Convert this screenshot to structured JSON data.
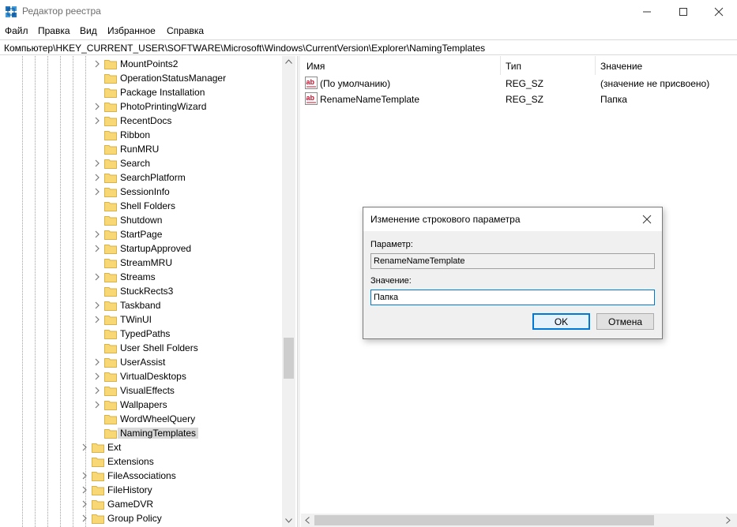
{
  "window": {
    "title": "Редактор реестра"
  },
  "menu": [
    "Файл",
    "Правка",
    "Вид",
    "Избранное",
    "Справка"
  ],
  "address": "Компьютер\\HKEY_CURRENT_USER\\SOFTWARE\\Microsoft\\Windows\\CurrentVersion\\Explorer\\NamingTemplates",
  "tree": {
    "items": [
      {
        "label": "MountPoints2",
        "expandable": true,
        "level": 2,
        "selected": false
      },
      {
        "label": "OperationStatusManager",
        "expandable": false,
        "level": 2,
        "selected": false
      },
      {
        "label": "Package Installation",
        "expandable": false,
        "level": 2,
        "selected": false
      },
      {
        "label": "PhotoPrintingWizard",
        "expandable": true,
        "level": 2,
        "selected": false
      },
      {
        "label": "RecentDocs",
        "expandable": true,
        "level": 2,
        "selected": false
      },
      {
        "label": "Ribbon",
        "expandable": false,
        "level": 2,
        "selected": false
      },
      {
        "label": "RunMRU",
        "expandable": false,
        "level": 2,
        "selected": false
      },
      {
        "label": "Search",
        "expandable": true,
        "level": 2,
        "selected": false
      },
      {
        "label": "SearchPlatform",
        "expandable": true,
        "level": 2,
        "selected": false
      },
      {
        "label": "SessionInfo",
        "expandable": true,
        "level": 2,
        "selected": false
      },
      {
        "label": "Shell Folders",
        "expandable": false,
        "level": 2,
        "selected": false
      },
      {
        "label": "Shutdown",
        "expandable": false,
        "level": 2,
        "selected": false
      },
      {
        "label": "StartPage",
        "expandable": true,
        "level": 2,
        "selected": false
      },
      {
        "label": "StartupApproved",
        "expandable": true,
        "level": 2,
        "selected": false
      },
      {
        "label": "StreamMRU",
        "expandable": false,
        "level": 2,
        "selected": false
      },
      {
        "label": "Streams",
        "expandable": true,
        "level": 2,
        "selected": false
      },
      {
        "label": "StuckRects3",
        "expandable": false,
        "level": 2,
        "selected": false
      },
      {
        "label": "Taskband",
        "expandable": true,
        "level": 2,
        "selected": false
      },
      {
        "label": "TWinUI",
        "expandable": true,
        "level": 2,
        "selected": false
      },
      {
        "label": "TypedPaths",
        "expandable": false,
        "level": 2,
        "selected": false
      },
      {
        "label": "User Shell Folders",
        "expandable": false,
        "level": 2,
        "selected": false
      },
      {
        "label": "UserAssist",
        "expandable": true,
        "level": 2,
        "selected": false
      },
      {
        "label": "VirtualDesktops",
        "expandable": true,
        "level": 2,
        "selected": false
      },
      {
        "label": "VisualEffects",
        "expandable": true,
        "level": 2,
        "selected": false
      },
      {
        "label": "Wallpapers",
        "expandable": true,
        "level": 2,
        "selected": false
      },
      {
        "label": "WordWheelQuery",
        "expandable": false,
        "level": 2,
        "selected": false
      },
      {
        "label": "NamingTemplates",
        "expandable": false,
        "level": 2,
        "selected": true
      },
      {
        "label": "Ext",
        "expandable": true,
        "level": 1,
        "selected": false
      },
      {
        "label": "Extensions",
        "expandable": false,
        "level": 1,
        "selected": false
      },
      {
        "label": "FileAssociations",
        "expandable": true,
        "level": 1,
        "selected": false
      },
      {
        "label": "FileHistory",
        "expandable": true,
        "level": 1,
        "selected": false
      },
      {
        "label": "GameDVR",
        "expandable": true,
        "level": 1,
        "selected": false
      },
      {
        "label": "Group Policy",
        "expandable": true,
        "level": 1,
        "selected": false
      }
    ]
  },
  "list": {
    "columns": [
      "Имя",
      "Тип",
      "Значение"
    ],
    "rows": [
      {
        "name": "(По умолчанию)",
        "type": "REG_SZ",
        "value": "(значение не присвоено)"
      },
      {
        "name": "RenameNameTemplate",
        "type": "REG_SZ",
        "value": "Папка"
      }
    ]
  },
  "dialog": {
    "title": "Изменение строкового параметра",
    "param_label": "Параметр:",
    "param_value": "RenameNameTemplate",
    "value_label": "Значение:",
    "value_text": "Папка",
    "ok_label": "OK",
    "cancel_label": "Отмена"
  },
  "colors": {
    "accent": "#0078d7",
    "folder": "#f8d775",
    "selection": "#d9d9d9",
    "string-icon": "#c8102e"
  }
}
